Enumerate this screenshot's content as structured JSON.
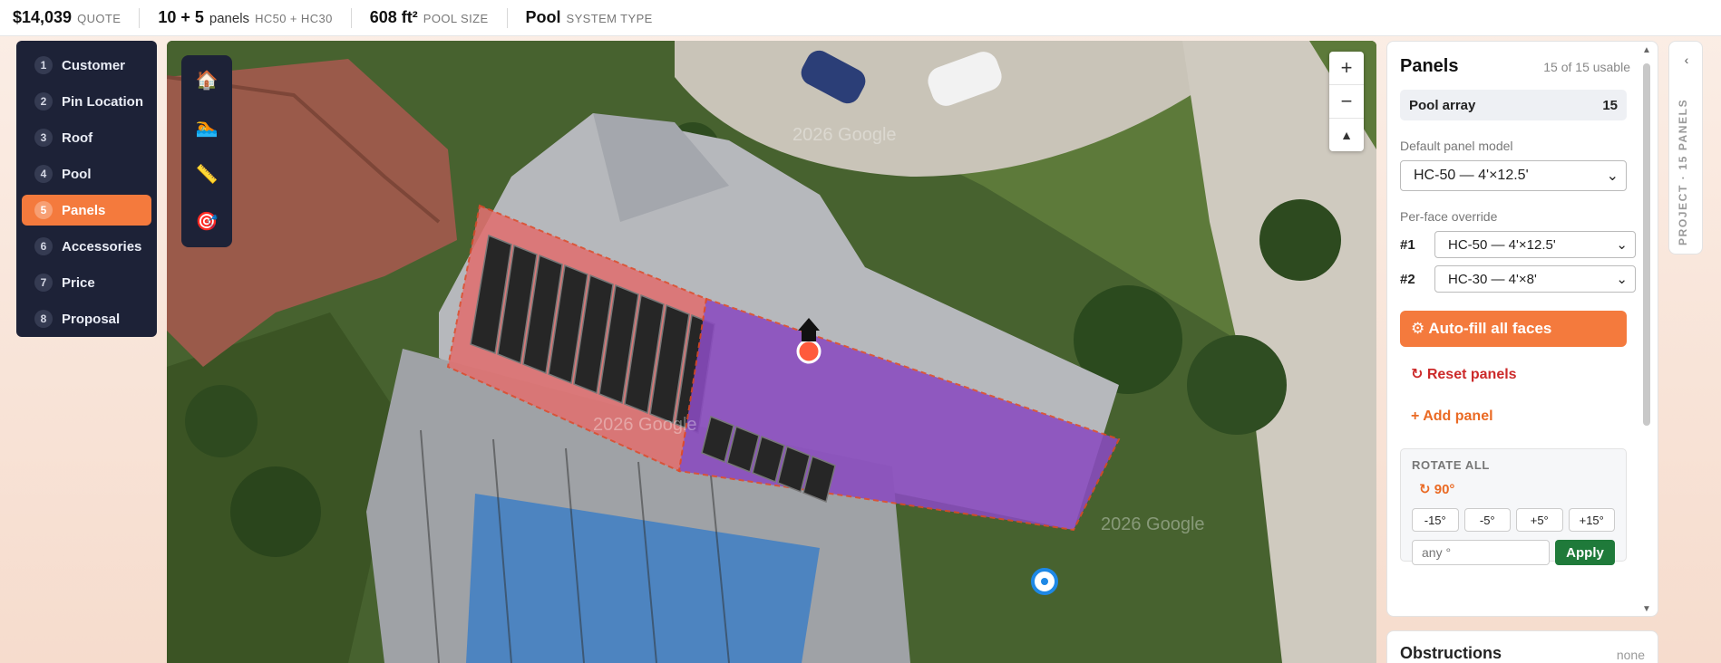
{
  "topbar": {
    "quote_value": "$14,039",
    "quote_label": "QUOTE",
    "panels_value": "10 + 5",
    "panels_word": "panels",
    "panels_models": "HC50 + HC30",
    "pool_value": "608 ft²",
    "pool_label": "POOL SIZE",
    "system_value": "Pool",
    "system_label": "SYSTEM TYPE"
  },
  "steps": [
    {
      "num": "1",
      "label": "Customer",
      "active": false
    },
    {
      "num": "2",
      "label": "Pin Location",
      "active": false
    },
    {
      "num": "3",
      "label": "Roof",
      "active": false
    },
    {
      "num": "4",
      "label": "Pool",
      "active": false
    },
    {
      "num": "5",
      "label": "Panels",
      "active": true
    },
    {
      "num": "6",
      "label": "Accessories",
      "active": false
    },
    {
      "num": "7",
      "label": "Price",
      "active": false
    },
    {
      "num": "8",
      "label": "Proposal",
      "active": false
    }
  ],
  "map": {
    "tools": [
      "house-icon",
      "pool-icon",
      "ruler-icon",
      "target-icon"
    ],
    "zoom_in": "+",
    "zoom_out": "−",
    "compass": "▲",
    "watermark": "2026 Google",
    "colors": {
      "face1": "#e07070",
      "face2": "#8a4bc0",
      "panel": "#262626"
    }
  },
  "panel": {
    "title": "Panels",
    "usable": "15 of 15 usable",
    "array_name": "Pool array",
    "array_count": "15",
    "default_label": "Default panel model",
    "default_value": "HC-50 — 4'×12.5'",
    "override_label": "Per-face override",
    "overrides": [
      {
        "face": "#1",
        "value": "HC-50 — 4'×12.5'"
      },
      {
        "face": "#2",
        "value": "HC-30 — 4'×8'"
      }
    ],
    "autofill": "⚙ Auto-fill all faces",
    "reset": "↻ Reset panels",
    "add": "+ Add panel",
    "rotate_title": "ROTATE ALL",
    "rotate_current": "↻ 90°",
    "rotate_steps": [
      "-15°",
      "-5°",
      "+5°",
      "+15°"
    ],
    "rotate_placeholder": "any °",
    "apply": "Apply"
  },
  "obstructions": {
    "title": "Obstructions",
    "note": "none"
  },
  "project_tab": {
    "chevron": "‹",
    "text": "PROJECT · 15 PANELS"
  }
}
